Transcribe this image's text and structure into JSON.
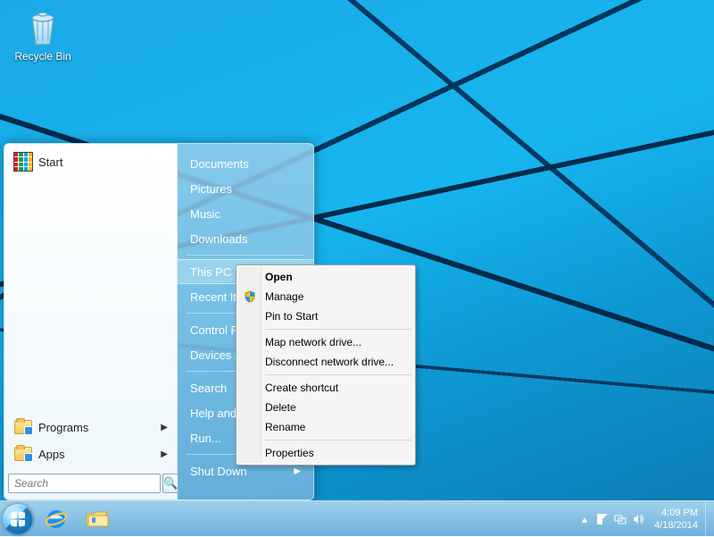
{
  "desktop": {
    "recycle_bin_label": "Recycle Bin"
  },
  "start_menu": {
    "header_label": "Start",
    "left_items": {
      "programs": "Programs",
      "apps": "Apps"
    },
    "search_placeholder": "Search",
    "right_items": [
      "Documents",
      "Pictures",
      "Music",
      "Downloads",
      "This PC",
      "Recent Items",
      "Control Panel",
      "Devices and Printers",
      "Search",
      "Help and Support",
      "Run...",
      "Shut Down"
    ],
    "selected_index": 4,
    "sep_after": [
      3,
      5,
      7,
      10
    ]
  },
  "context_menu": {
    "items": [
      {
        "label": "Open",
        "bold": true
      },
      {
        "label": "Manage",
        "icon": "shield"
      },
      {
        "label": "Pin to Start"
      },
      {
        "sep": true
      },
      {
        "label": "Map network drive..."
      },
      {
        "label": "Disconnect network drive..."
      },
      {
        "sep": true
      },
      {
        "label": "Create shortcut"
      },
      {
        "label": "Delete"
      },
      {
        "label": "Rename"
      },
      {
        "sep": true
      },
      {
        "label": "Properties"
      }
    ]
  },
  "taskbar": {
    "tray_arrow_glyph": "▴",
    "time": "4:09 PM",
    "date": "4/18/2014"
  }
}
